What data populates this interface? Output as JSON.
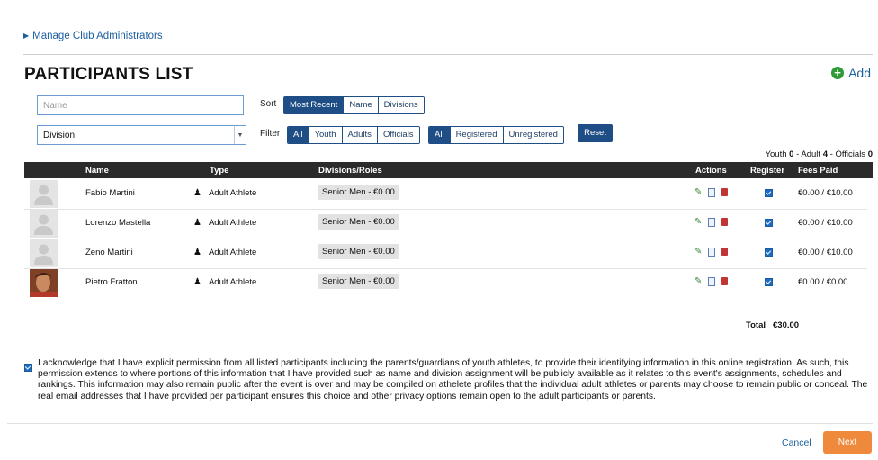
{
  "nav": {
    "manage_link": "Manage Club Administrators"
  },
  "page": {
    "title": "PARTICIPANTS LIST",
    "add_label": "Add"
  },
  "filters": {
    "name_placeholder": "Name",
    "division_value": "Division",
    "sort_label": "Sort",
    "sort_options": [
      "Most Recent",
      "Name",
      "Divisions"
    ],
    "sort_active": "Most Recent",
    "filter_label": "Filter",
    "type_options": [
      "All",
      "Youth",
      "Adults",
      "Officials"
    ],
    "reg_options": [
      "All",
      "Registered",
      "Unregistered"
    ],
    "reset_label": "Reset"
  },
  "summary": {
    "youth_label": "Youth",
    "youth_count": "0",
    "adult_label": "Adult",
    "adult_count": "4",
    "officials_label": "Officials",
    "officials_count": "0"
  },
  "table": {
    "headers": {
      "name": "Name",
      "type": "Type",
      "divisions": "Divisions/Roles",
      "actions": "Actions",
      "register": "Register",
      "fees": "Fees Paid"
    },
    "rows": [
      {
        "name": "Fabio Martini",
        "type": "Adult Athlete",
        "division": "Senior Men - €0.00",
        "fees": "€0.00 / €10.00",
        "registered": true,
        "avatar": "default-avatar"
      },
      {
        "name": "Lorenzo Mastella",
        "type": "Adult Athlete",
        "division": "Senior Men - €0.00",
        "fees": "€0.00 / €10.00",
        "registered": true,
        "avatar": "default-avatar"
      },
      {
        "name": "Zeno Martini",
        "type": "Adult Athlete",
        "division": "Senior Men - €0.00",
        "fees": "€0.00 / €10.00",
        "registered": true,
        "avatar": "default-avatar"
      },
      {
        "name": "Pietro Fratton",
        "type": "Adult Athlete",
        "division": "Senior Men - €0.00",
        "fees": "€0.00 / €0.00",
        "registered": true,
        "avatar": "photo-avatar"
      }
    ]
  },
  "total": {
    "label": "Total",
    "amount": "€30.00"
  },
  "acknowledgement": {
    "checked": true,
    "text": "I acknowledge that I have explicit permission from all listed participants including the parents/guardians of youth athletes, to provide their identifying information in this online registration. As such, this permission extends to where portions of this information that I have provided such as name and division assignment will be publicly available as it relates to this event's assignments, schedules and rankings. This information may also remain public after the event is over and may be compiled on athelete profiles that the individual adult athletes or parents may choose to remain public or conceal. The real email addresses that I have provided per participant ensures this choice and other privacy options remain open to the adult participants or parents."
  },
  "footer": {
    "cancel_label": "Cancel",
    "next_label": "Next"
  },
  "colors": {
    "primary": "#1f4d86",
    "link": "#1b5f9e",
    "add_green": "#2f9a37",
    "next_orange": "#ef8a3c",
    "header_bg": "#2b2b2b"
  },
  "icons": {
    "add": "plus-circle-icon",
    "edit": "pencil-icon",
    "view": "document-icon",
    "delete": "trash-icon",
    "type": "person-icon"
  }
}
